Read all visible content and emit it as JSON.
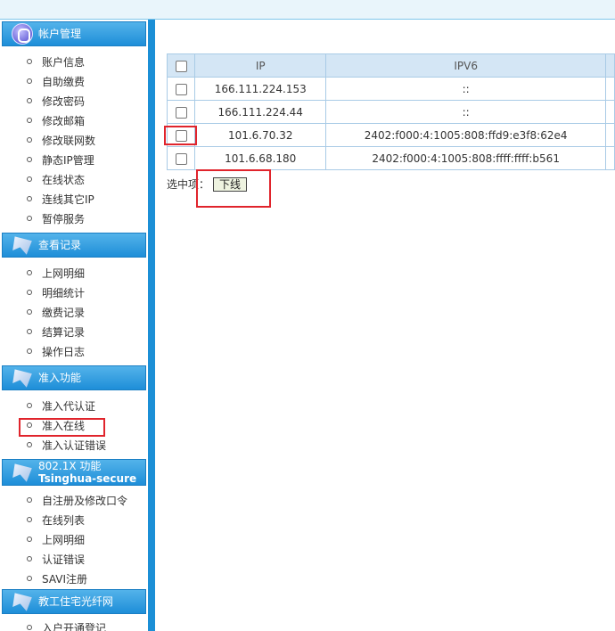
{
  "sidebar": {
    "sections": [
      {
        "title": "帐户管理",
        "icon": "account-icon",
        "items": [
          "账户信息",
          "自助缴费",
          "修改密码",
          "修改邮箱",
          "修改联网数",
          "静态IP管理",
          "在线状态",
          "连线其它IP",
          "暂停服务"
        ]
      },
      {
        "title": "查看记录",
        "icon": "records-icon",
        "items": [
          "上网明细",
          "明细统计",
          "缴费记录",
          "结算记录",
          "操作日志"
        ]
      },
      {
        "title": "准入功能",
        "icon": "access-icon",
        "items": [
          "准入代认证",
          "准入在线",
          "准入认证错误"
        ]
      },
      {
        "title": "802.1X 功能",
        "title2": "Tsinghua-secure",
        "icon": "dot1x-icon",
        "items": [
          "自注册及修改口令",
          "在线列表",
          "上网明细",
          "认证错误",
          "SAVI注册"
        ]
      },
      {
        "title": "教工住宅光纤网",
        "icon": "fiber-icon",
        "items": [
          "入户开通登记"
        ]
      }
    ]
  },
  "table": {
    "headers": [
      "IP",
      "IPV6"
    ],
    "rows": [
      {
        "ip": "166.111.224.153",
        "ipv6": "::"
      },
      {
        "ip": "166.111.224.44",
        "ipv6": "::"
      },
      {
        "ip": "101.6.70.32",
        "ipv6": "2402:f000:4:1005:808:ffd9:e3f8:62e4"
      },
      {
        "ip": "101.6.68.180",
        "ipv6": "2402:f000:4:1005:808:ffff:ffff:b561"
      }
    ]
  },
  "actions": {
    "selected_label": "选中项：",
    "offline_button": "下线"
  },
  "colors": {
    "accent": "#1b8fd6",
    "highlight": "#e0242c",
    "table_header": "#d4e6f5"
  }
}
